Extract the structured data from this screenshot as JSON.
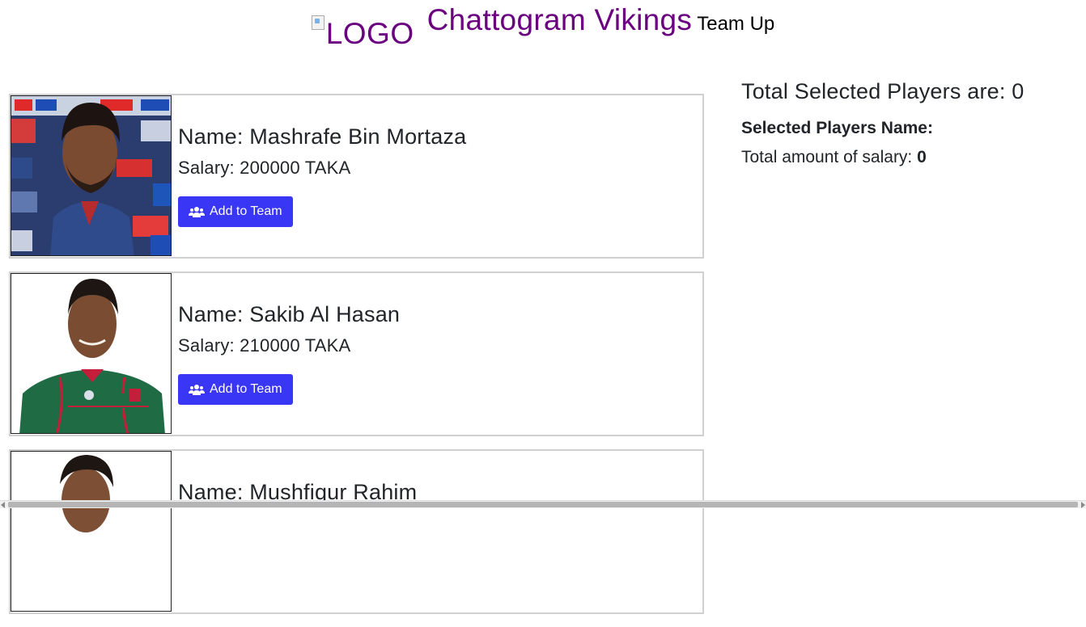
{
  "header": {
    "logo_alt": "LOGO",
    "brand": "Chattogram Vikings",
    "tagline": "Team Up"
  },
  "players": [
    {
      "name_label": "Name: Mashrafe Bin Mortaza",
      "salary_label": "Salary: 200000 TAKA",
      "button_label": "Add to Team",
      "photo": "player-photo-mashrafe"
    },
    {
      "name_label": "Name: Sakib Al Hasan",
      "salary_label": "Salary: 210000 TAKA",
      "button_label": "Add to Team",
      "photo": "player-photo-sakib"
    },
    {
      "name_label": "Name: Mushfiqur Rahim",
      "salary_label": "",
      "button_label": "",
      "photo": "player-photo-mushfiqur"
    }
  ],
  "summary": {
    "total_selected": "Total Selected Players are: 0",
    "selected_names_label": "Selected Players Name:",
    "total_salary_label": "Total amount of salary: ",
    "total_salary_value": "0"
  },
  "colors": {
    "brand": "#6a0080",
    "button": "#3a36f5"
  },
  "icons": {
    "button_icon": "users-icon"
  }
}
